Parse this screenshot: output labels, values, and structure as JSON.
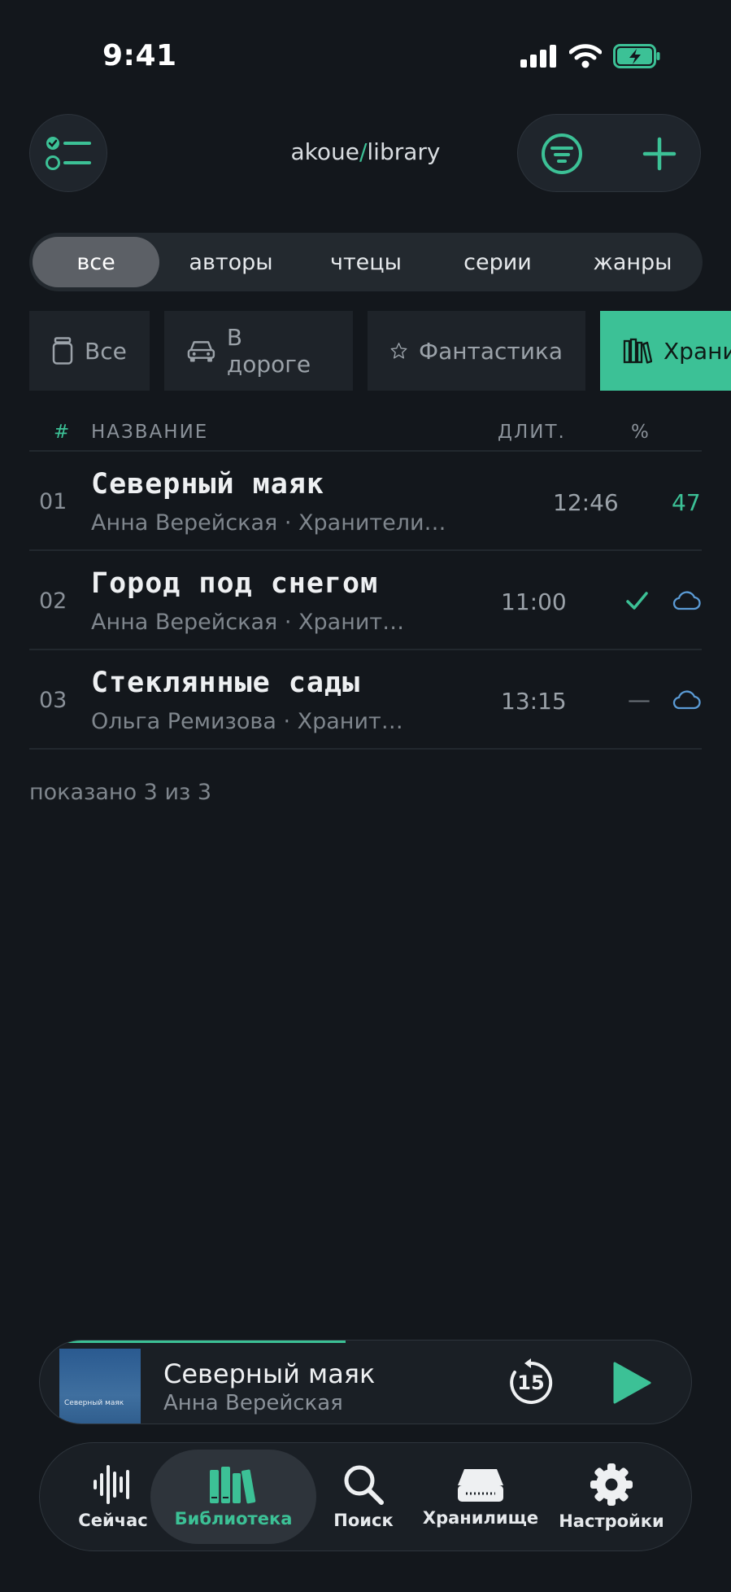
{
  "status_bar": {
    "time": "9:41"
  },
  "header": {
    "brand_left": "akoue",
    "brand_sep": "/",
    "brand_right": "library"
  },
  "segments": [
    {
      "label": "все",
      "active": true
    },
    {
      "label": "авторы"
    },
    {
      "label": "чтецы"
    },
    {
      "label": "серии"
    },
    {
      "label": "жанры"
    }
  ],
  "chips": [
    {
      "label": "Все",
      "icon": "jar-icon"
    },
    {
      "label": "В дороге",
      "icon": "car-icon"
    },
    {
      "label": "Фантастика",
      "icon": "star-icon"
    },
    {
      "label": "Хранилище",
      "icon": "books-icon",
      "active": true
    }
  ],
  "table": {
    "headers": {
      "num": "#",
      "title": "НАЗВАНИЕ",
      "duration": "ДЛИТ.",
      "percent": "%"
    },
    "rows": [
      {
        "num": "01",
        "title": "Северный маяк",
        "subtitle": "Анна Верейская · Хранители…",
        "duration": "12:46",
        "percent": "47"
      },
      {
        "num": "02",
        "title": "Город под снегом",
        "subtitle": "Анна Верейская · Хранит…",
        "duration": "11:00",
        "status": "check-icon",
        "cloud": "cloud-icon"
      },
      {
        "num": "03",
        "title": "Стеклянные сады",
        "subtitle": "Ольга Ремизова · Хранит…",
        "duration": "13:15",
        "dash": "—",
        "cloud": "cloud-icon"
      }
    ],
    "footer": "показано 3 из 3"
  },
  "player": {
    "title": "Северный маяк",
    "author": "Анна Верейская",
    "cover_text": "Северный маяк",
    "skip_label": "15",
    "progress": 0.47
  },
  "tabs": [
    {
      "label": "Сейчас",
      "icon": "waveform-icon"
    },
    {
      "label": "Библиотека",
      "icon": "library-icon",
      "active": true
    },
    {
      "label": "Поиск",
      "icon": "search-icon"
    },
    {
      "label": "Хранилище",
      "icon": "storage-icon"
    },
    {
      "label": "Настройки",
      "icon": "gear-icon"
    }
  ],
  "colors": {
    "accent": "#3cc196",
    "background": "#13171c",
    "cloud": "#5b9bd5"
  }
}
